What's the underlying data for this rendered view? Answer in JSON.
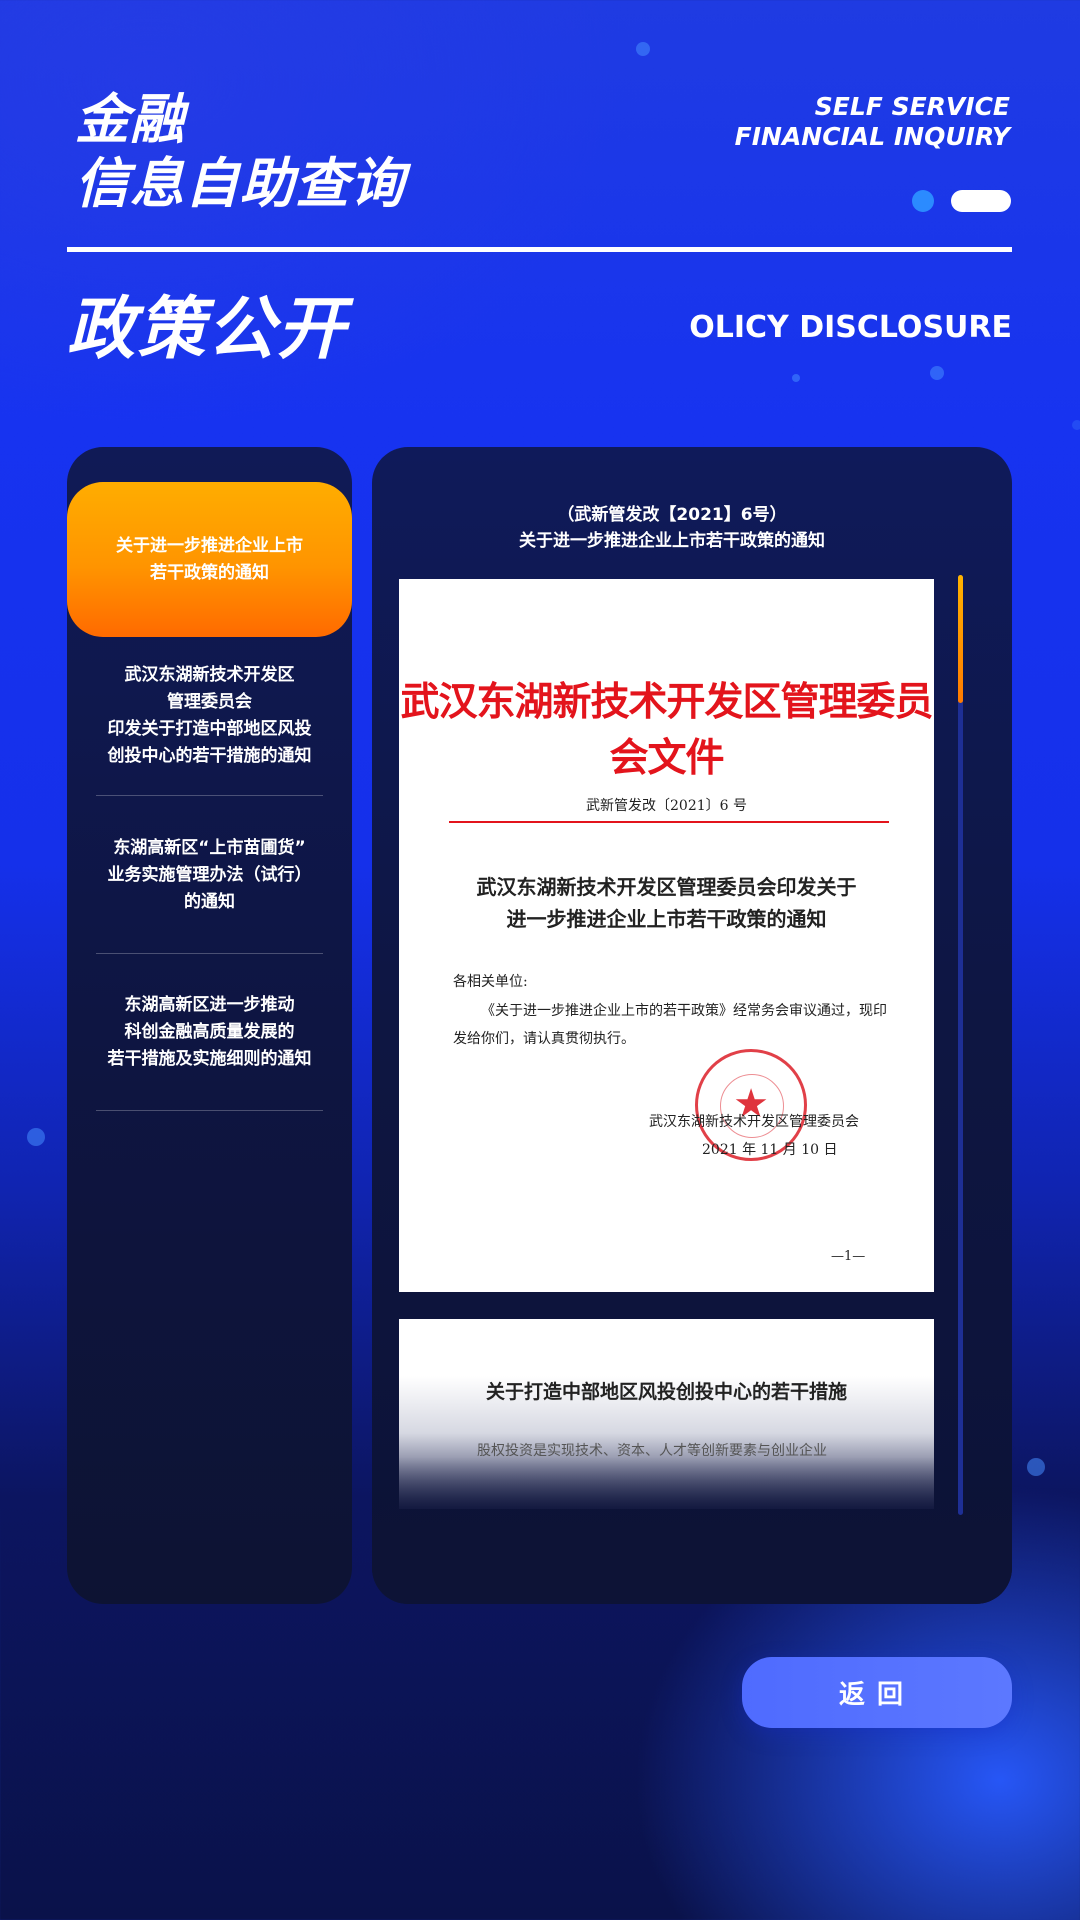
{
  "header": {
    "title_line1": "金融",
    "title_line2": "信息自助查询",
    "en_line1": "SELF SERVICE",
    "en_line2": "FINANCIAL INQUIRY"
  },
  "section": {
    "title_cn": "政策公开",
    "title_en": "OLICY DISCLOSURE"
  },
  "nav": {
    "items": [
      {
        "label": "关于进一步推进企业上市\n若干政策的通知",
        "active": true
      },
      {
        "label": "武汉东湖新技术开发区\n管理委员会\n印发关于打造中部地区风投\n创投中心的若干措施的通知",
        "active": false
      },
      {
        "label": "东湖高新区“上市苗圃货”\n业务实施管理办法（试行）\n的通知",
        "active": false
      },
      {
        "label": "东湖高新区进一步推动\n科创金融高质量发展的\n若干措施及实施细则的通知",
        "active": false
      }
    ]
  },
  "document": {
    "head_line1": "（武新管发改【2021】6号）",
    "head_line2": "关于进一步推进企业上市若干政策的通知",
    "page1": {
      "red_header": "武汉东湖新技术开发区管理委员会文件",
      "doc_number": "武新管发改〔2021〕6 号",
      "title_line1": "武汉东湖新技术开发区管理委员会印发关于",
      "title_line2": "进一步推进企业上市若干政策的通知",
      "addressee": "各相关单位:",
      "body": "《关于进一步推进企业上市的若干政策》经常务会审议通过，现印发给你们，请认真贯彻执行。",
      "signature_org": "武汉东湖新技术开发区管理委员会",
      "signature_date": "2021 年 11 月 10 日",
      "page_number": "—1—"
    },
    "page2": {
      "title": "关于打造中部地区风投创投中心的若干措施",
      "body": "股权投资是实现技术、资本、人才等创新要素与创业企业"
    }
  },
  "scroll_position": 0.0,
  "back_button": "返回",
  "colors": {
    "accent_orange": "#ff9400",
    "brand_blue": "#1530ea",
    "seal_red": "#e3141c"
  }
}
